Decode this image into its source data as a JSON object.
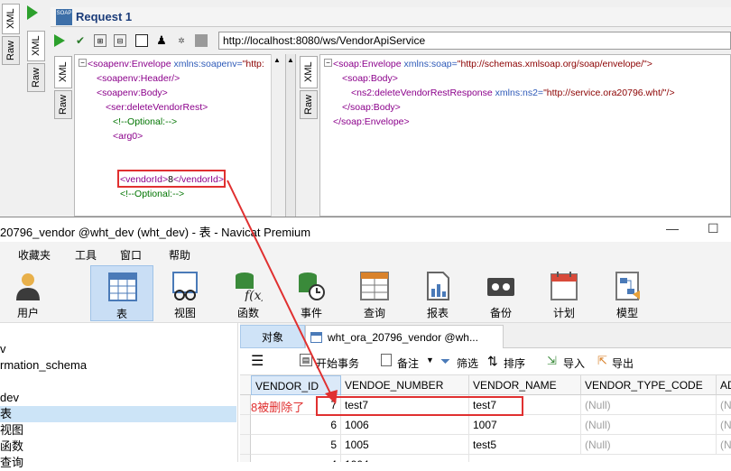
{
  "soapui": {
    "outer_tabs": [
      "XML",
      "Raw"
    ],
    "request_tab_icon": "SOAP",
    "request_title": "Request 1",
    "url": "http://localhost:8080/ws/VendorApiService",
    "req_tabs": [
      "XML",
      "Raw"
    ],
    "resp_tabs": [
      "XML",
      "Raw"
    ],
    "request_xml": {
      "envelope_open": "<soapenv:Envelope",
      "envelope_attr": "xmlns:soapenv=",
      "envelope_val": "\"http:",
      "header": "<soapenv:Header/>",
      "body_open": "<soapenv:Body>",
      "op_open": "<ser:deleteVendorRest>",
      "comment1": "<!--Optional:-->",
      "arg0_open": "<arg0>",
      "vendor_open": "<vendorId>",
      "vendor_value": "8",
      "vendor_close": "</vendorId>",
      "comment2": "<!--Optional:-->"
    },
    "response_xml": {
      "envelope_open": "<soap:Envelope",
      "envelope_attr": "xmlns:soap=",
      "envelope_val": "\"http://schemas.xmlsoap.org/soap/envelope/\">",
      "body_open": "<soap:Body>",
      "resp_open": "<ns2:deleteVendorRestResponse",
      "resp_attr": "xmlns:ns2=",
      "resp_val": "\"http://service.ora20796.wht/\"/>",
      "body_close": "</soap:Body>",
      "envelope_close": "</soap:Envelope>"
    }
  },
  "navicat": {
    "window_title": "20796_vendor @wht_dev (wht_dev) - 表 - Navicat Premium",
    "menu": [
      "收藏夹",
      "工具",
      "窗口",
      "帮助"
    ],
    "ribbon": [
      {
        "label": "用户",
        "icon": "user-icon"
      },
      {
        "label": "表",
        "icon": "table-icon"
      },
      {
        "label": "视图",
        "icon": "view-icon"
      },
      {
        "label": "函数",
        "icon": "function-icon"
      },
      {
        "label": "事件",
        "icon": "event-icon"
      },
      {
        "label": "查询",
        "icon": "query-icon"
      },
      {
        "label": "报表",
        "icon": "report-icon"
      },
      {
        "label": "备份",
        "icon": "backup-icon"
      },
      {
        "label": "计划",
        "icon": "schedule-icon"
      },
      {
        "label": "模型",
        "icon": "model-icon"
      }
    ],
    "tree": [
      "v",
      "rmation_schema",
      "",
      "dev",
      "表",
      "视图",
      "函数",
      "查询"
    ],
    "tabs": {
      "objects": "对象",
      "table": "wht_ora_20796_vendor @wh..."
    },
    "grid_toolbar": [
      "开始事务",
      "备注",
      "筛选",
      "排序",
      "导入",
      "导出"
    ],
    "columns": [
      "VENDOR_ID",
      "VENDOE_NUMBER",
      "VENDOR_NAME",
      "VENDOR_TYPE_CODE",
      "AD"
    ],
    "rows": [
      [
        "7",
        "test7",
        "test7",
        "(Null)",
        "(N"
      ],
      [
        "6",
        "1006",
        "1007",
        "(Null)",
        "(N"
      ],
      [
        "5",
        "1005",
        "test5",
        "(Null)",
        "(N"
      ],
      [
        "4",
        "1004",
        "",
        "",
        ""
      ]
    ]
  },
  "annotation": {
    "text": "8被删除了",
    "color": "#e03030"
  }
}
